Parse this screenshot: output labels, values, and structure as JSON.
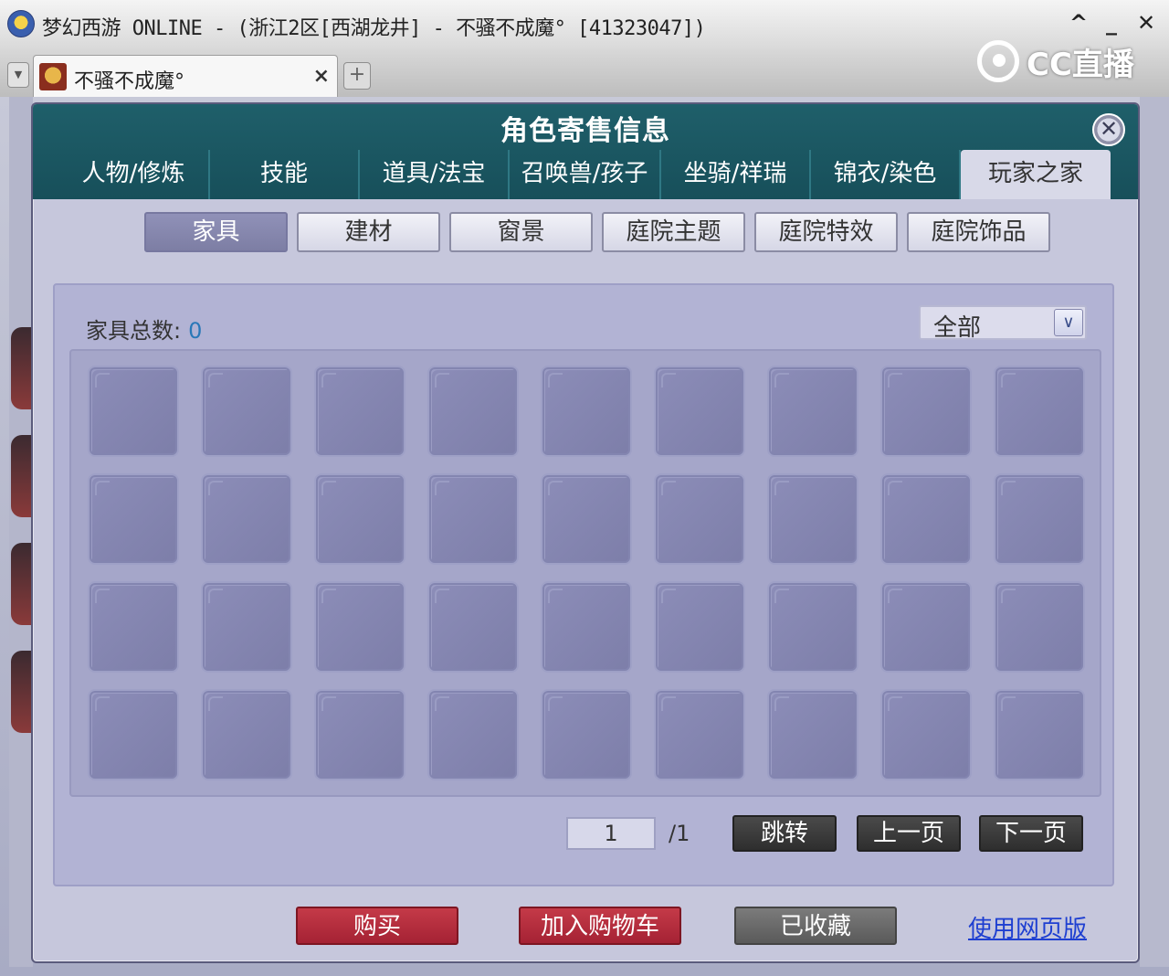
{
  "window": {
    "title": "梦幻西游 ONLINE - (浙江2区[西湖龙井] - 不骚不成魔° [41323047])",
    "controls": [
      "^",
      "_",
      "✕"
    ]
  },
  "browser": {
    "tab_title": "不骚不成魔°",
    "tab_close": "×",
    "new_tab": "+",
    "brand": "CC直播"
  },
  "dialog": {
    "title": "角色寄售信息",
    "close": "✕",
    "main_tabs": [
      "人物/修炼",
      "技能",
      "道具/法宝",
      "召唤兽/孩子",
      "坐骑/祥瑞",
      "锦衣/染色",
      "玩家之家"
    ],
    "active_main_tab": "玩家之家",
    "sub_tabs": [
      "家具",
      "建材",
      "窗景",
      "庭院主题",
      "庭院特效",
      "庭院饰品"
    ],
    "active_sub_tab": "家具",
    "count_label": "家具总数:",
    "count_value": "0",
    "filter_value": "全部",
    "filter_arrow": "∨",
    "pager": {
      "current_page": "1",
      "total": "/1",
      "jump": "跳转",
      "prev": "上一页",
      "next": "下一页"
    },
    "actions": {
      "buy": "购买",
      "add_cart": "加入购物车",
      "favorited": "已收藏",
      "web_version": "使用网页版"
    }
  },
  "colors": {
    "header": "#1f5f6a",
    "dialog_bg": "#c6c7dc",
    "slot": "#8586b2",
    "buy_red": "#b52c3c",
    "link_blue": "#1e3fd1"
  }
}
